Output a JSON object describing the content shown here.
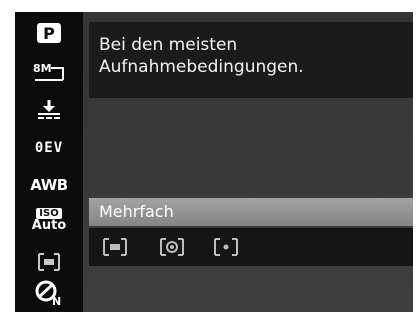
{
  "sidebar": {
    "items": [
      {
        "icon": "program-mode-icon",
        "glyph": "P"
      },
      {
        "icon": "resolution-8m-icon",
        "glyph": "8M"
      },
      {
        "icon": "quality-icon",
        "glyph": ""
      },
      {
        "icon": "exposure-compensation-icon",
        "glyph": "0EV"
      },
      {
        "icon": "white-balance-icon",
        "glyph": "AWB"
      },
      {
        "icon": "iso-auto-icon",
        "glyph_top": "ISO",
        "glyph_bottom": "Auto"
      },
      {
        "icon": "metering-icon",
        "glyph": ""
      },
      {
        "icon": "color-mode-icon",
        "glyph": "N"
      }
    ]
  },
  "description": {
    "line1": "Bei den meisten",
    "line2": "Aufnahmebedingungen."
  },
  "metering": {
    "selected_label": "Mehrfach",
    "options": [
      {
        "icon": "multi-metering-icon"
      },
      {
        "icon": "center-weighted-metering-icon"
      },
      {
        "icon": "spot-metering-icon"
      }
    ]
  }
}
